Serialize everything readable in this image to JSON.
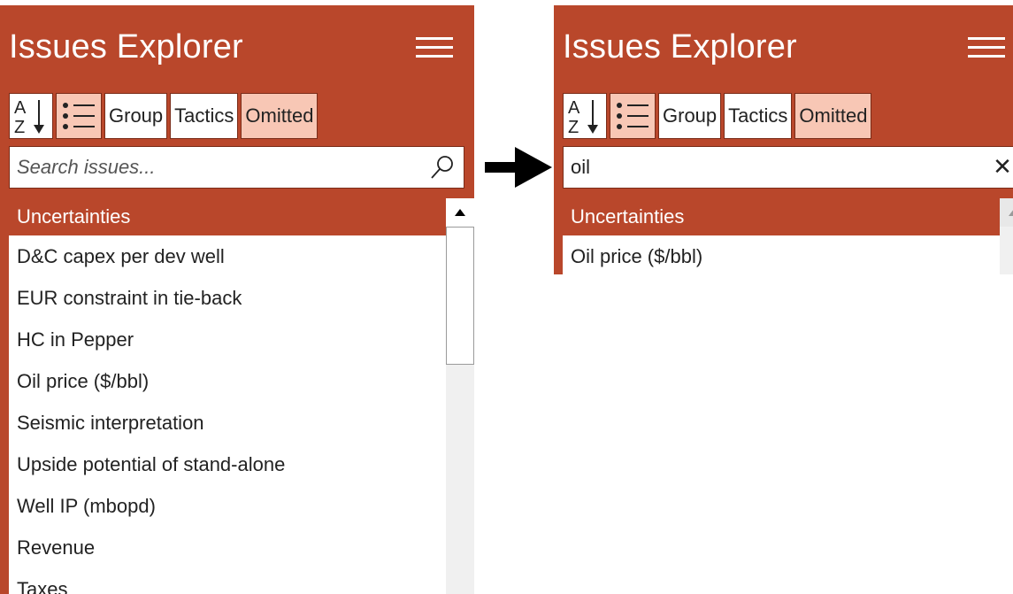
{
  "left_panel": {
    "title": "Issues Explorer",
    "toolbar": {
      "sort_az_label": "A Z",
      "group_label": "Group",
      "tactics_label": "Tactics",
      "omitted_label": "Omitted"
    },
    "search": {
      "value": "",
      "placeholder": "Search issues..."
    },
    "group_header": "Uncertainties",
    "items": [
      "D&C capex per dev well",
      "EUR constraint in tie-back",
      "HC in Pepper",
      "Oil price ($/bbl)",
      "Seismic interpretation",
      "Upside potential of stand-alone",
      "Well IP (mbopd)",
      "Revenue",
      "Taxes"
    ]
  },
  "right_panel": {
    "title": "Issues Explorer",
    "toolbar": {
      "sort_az_label": "A Z",
      "group_label": "Group",
      "tactics_label": "Tactics",
      "omitted_label": "Omitted"
    },
    "search": {
      "value": "oil",
      "placeholder": "Search issues..."
    },
    "group_header": "Uncertainties",
    "items": [
      "Oil price ($/bbl)"
    ]
  },
  "icons": {
    "menu": "hamburger-icon",
    "sort": "sort-az-icon",
    "list": "list-icon",
    "search": "search-icon",
    "clear": "close-icon",
    "arrow": "arrow-right-icon"
  },
  "colors": {
    "header_bg": "#B9472B",
    "toggle_on": "#F8C7B5",
    "text": "#222222"
  }
}
